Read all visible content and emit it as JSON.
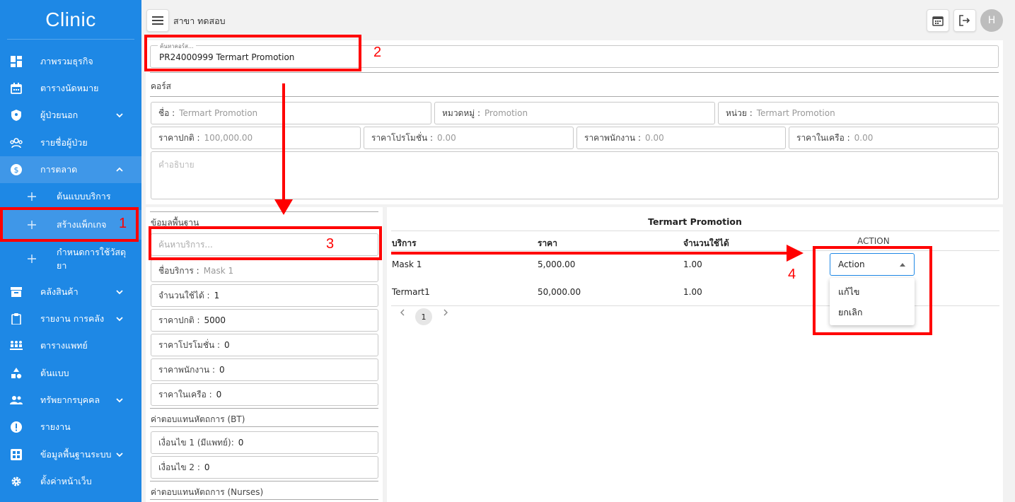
{
  "sidebar": {
    "brand": "Clinic",
    "items": [
      {
        "label": "ภาพรวมธุรกิจ",
        "icon": "dashboard-icon"
      },
      {
        "label": "ตารางนัดหมาย",
        "icon": "calendar-icon"
      },
      {
        "label": "ผู้ป่วยนอก",
        "icon": "shield-icon"
      },
      {
        "label": "รายชื่อผู้ป่วย",
        "icon": "patients-icon"
      },
      {
        "label": "การตลาด",
        "icon": "dollar-icon"
      },
      {
        "label": "คลังสินค้า",
        "icon": "warehouse-icon"
      },
      {
        "label": "รายงาน การคลัง",
        "icon": "clipboard-icon"
      },
      {
        "label": "ตารางแพทย์",
        "icon": "doctor-schedule-icon"
      },
      {
        "label": "ต้นแบบ",
        "icon": "shapes-icon"
      },
      {
        "label": "ทรัพยากรบุคคล",
        "icon": "people-icon"
      },
      {
        "label": "รายงาน",
        "icon": "alert-icon"
      },
      {
        "label": "ข้อมูลพื้นฐานระบบ",
        "icon": "grid-icon"
      },
      {
        "label": "ตั้งค่าหน้าเว็บ",
        "icon": "gear-icon"
      }
    ],
    "sub_items": [
      {
        "label": "ต้นแบบบริการ"
      },
      {
        "label": "สร้างแพ็กเกจ"
      },
      {
        "label": "กำหนดการใช้วัสดุยา"
      }
    ]
  },
  "topbar": {
    "branch": "สาขา ทดสอบ",
    "avatar": "H"
  },
  "course_search": {
    "legend": "ค้นหาคอร์ส...",
    "value": "PR24000999 Termart Promotion"
  },
  "course": {
    "title": "คอร์ส",
    "name_label": "ชื่อ :",
    "name_value": "Termart Promotion",
    "category_label": "หมวดหมู่ :",
    "category_value": "Promotion",
    "unit_label": "หน่วย :",
    "unit_value": "Termart Promotion",
    "normal_price_label": "ราคาปกติ :",
    "normal_price_value": "100,000.00",
    "promo_price_label": "ราคาโปรโมชั่น :",
    "promo_price_value": "0.00",
    "staff_price_label": "ราคาพนักงาน :",
    "staff_price_value": "0.00",
    "network_price_label": "ราคาในเครือ :",
    "network_price_value": "0.00",
    "description_placeholder": "คำอธิบาย"
  },
  "basic": {
    "title": "ข้อมูลพื้นฐาน",
    "search_placeholder": "ค้นหาบริการ...",
    "service_name_label": "ชื่อบริการ :",
    "service_name_value": "Mask 1",
    "usable_qty_label": "จำนวนใช้ได้ :",
    "usable_qty_value": "1",
    "normal_price_label": "ราคาปกติ :",
    "normal_price_value": "5000",
    "promo_price_label": "ราคาโปรโมชั่น :",
    "promo_price_value": "0",
    "staff_price_label": "ราคาพนักงาน :",
    "staff_price_value": "0",
    "network_price_label": "ราคาในเครือ :",
    "network_price_value": "0",
    "bt_title": "ค่าตอบแทนหัตถการ (BT)",
    "cond1_label": "เงื่อนไข 1 (มีแพทย์):",
    "cond1_value": "0",
    "cond2_label": "เงื่อนไข 2 :",
    "cond2_value": "0",
    "nurses_title": "ค่าตอบแทนหัตถการ (Nurses)"
  },
  "package_table": {
    "title": "Termart Promotion",
    "headers": [
      "บริการ",
      "ราคา",
      "จำนวนใช้ได้",
      "ACTION"
    ],
    "rows": [
      {
        "service": "Mask 1",
        "price": "5,000.00",
        "qty": "1.00"
      },
      {
        "service": "Termart1",
        "price": "50,000.00",
        "qty": "1.00"
      }
    ],
    "action_label": "Action",
    "menu": [
      "แก้ไข",
      "ยกเลิก"
    ],
    "page": "1"
  },
  "annotations": [
    "1",
    "2",
    "3",
    "4"
  ],
  "colors": {
    "sidebar": "#1e88e5",
    "annotation": "#ff0000"
  }
}
